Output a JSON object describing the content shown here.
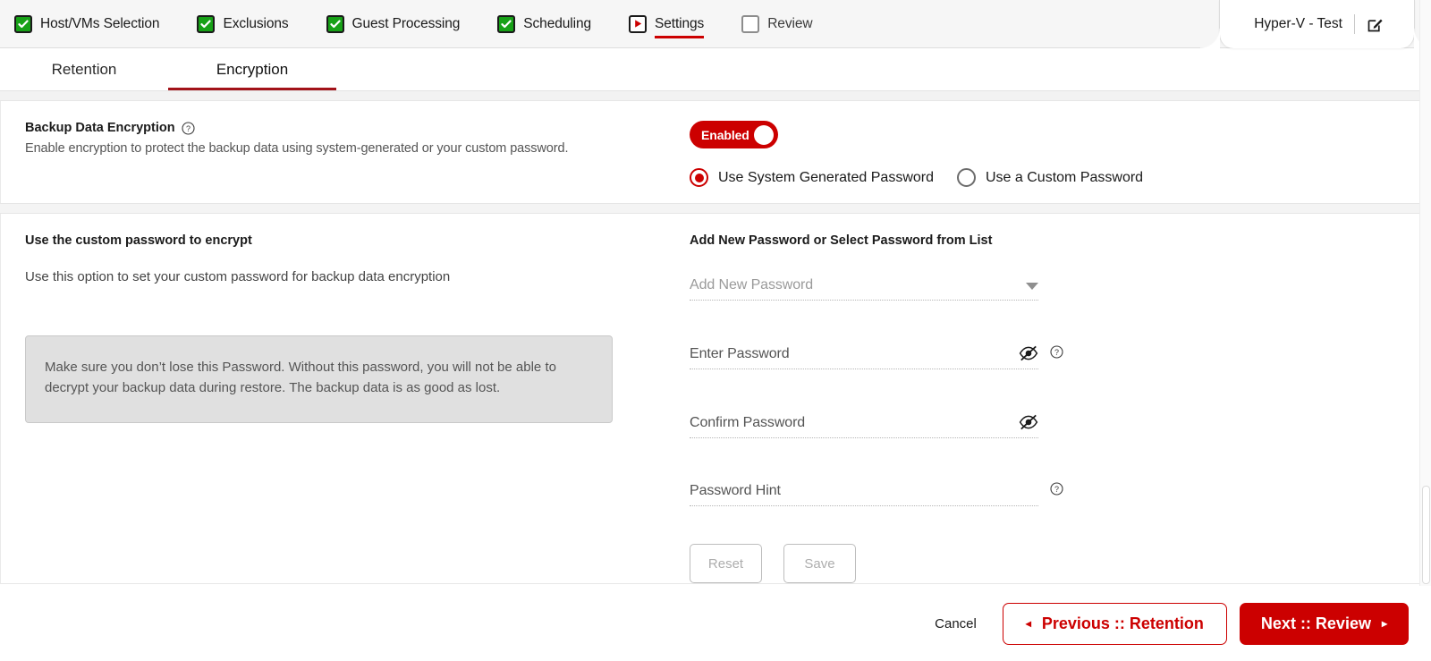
{
  "wizard": {
    "steps": [
      {
        "label": "Host/VMs Selection",
        "state": "done"
      },
      {
        "label": "Exclusions",
        "state": "done"
      },
      {
        "label": "Guest Processing",
        "state": "done"
      },
      {
        "label": "Scheduling",
        "state": "done"
      },
      {
        "label": "Settings",
        "state": "current"
      },
      {
        "label": "Review",
        "state": "todo"
      }
    ],
    "job_name": "Hyper-V - Test",
    "edit_icon": "edit-square-icon"
  },
  "subtabs": [
    {
      "label": "Retention",
      "active": false
    },
    {
      "label": "Encryption",
      "active": true
    }
  ],
  "encryption_section": {
    "title": "Backup Data Encryption",
    "help_icon": "question-circle-icon",
    "description": "Enable encryption to protect the backup data using system-generated or your custom password.",
    "toggle": {
      "label": "Enabled",
      "state": "on"
    },
    "radios": [
      {
        "label": "Use System Generated Password",
        "selected": true
      },
      {
        "label": "Use a Custom Password",
        "selected": false
      }
    ]
  },
  "custom_password": {
    "title": "Use the custom password to encrypt",
    "subtitle": "Use this option to set your custom password for backup data encryption",
    "warning": "Make sure you don’t lose this Password. Without this password, you will not be able to decrypt your backup data during restore. The backup data is as good as lost.",
    "form_title": "Add New Password or Select Password from List",
    "select": {
      "placeholder": "Add New Password",
      "value": "",
      "caret_icon": "chevron-down-icon",
      "options": [
        "Add New Password"
      ]
    },
    "password_field": {
      "placeholder": "Enter Password",
      "value": "",
      "eye_icon": "eye-slash-icon",
      "help_icon": "question-circle-icon"
    },
    "confirm_field": {
      "placeholder": "Confirm Password",
      "value": "",
      "eye_icon": "eye-slash-icon"
    },
    "hint_field": {
      "placeholder": "Password Hint",
      "value": "",
      "help_icon": "question-circle-icon"
    },
    "buttons": {
      "reset": "Reset",
      "save": "Save"
    }
  },
  "footer": {
    "cancel": "Cancel",
    "previous": "Previous :: Retention",
    "next": "Next :: Review",
    "prev_arrow": "◂",
    "next_arrow": "▸"
  },
  "colors": {
    "brand_red": "#cc0000",
    "tab_underline": "#a21219",
    "check_green": "#17a117"
  }
}
